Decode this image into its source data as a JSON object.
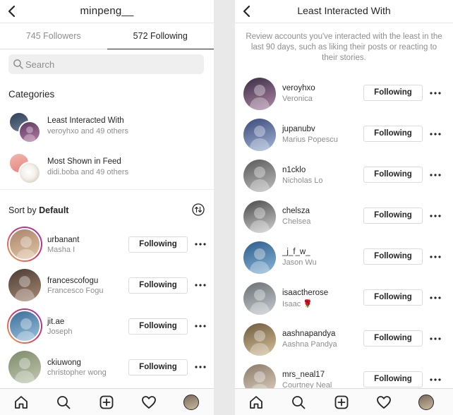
{
  "left": {
    "header": {
      "title": "minpeng__",
      "back_icon": "back-chevron-icon"
    },
    "tabs": [
      {
        "label": "745 Followers",
        "active": false
      },
      {
        "label": "572 Following",
        "active": true
      }
    ],
    "search": {
      "placeholder": "Search",
      "value": ""
    },
    "categories_heading": "Categories",
    "categories": [
      {
        "name": "Least Interacted With",
        "sub": "veroyhxo and 49 others"
      },
      {
        "name": "Most Shown in Feed",
        "sub": "didi.boba and 49 others"
      }
    ],
    "sort": {
      "prefix": "Sort by",
      "value": "Default"
    },
    "users": [
      {
        "username": "urbanant",
        "name": "Masha I",
        "button": "Following",
        "story_ring": true
      },
      {
        "username": "francescofogu",
        "name": "Francesco Fogu",
        "button": "Following",
        "story_ring": false
      },
      {
        "username": "jit.ae",
        "name": "Joseph",
        "button": "Following",
        "story_ring": true
      },
      {
        "username": "ckiuwong",
        "name": "christopher wong",
        "button": "Following",
        "story_ring": false
      }
    ]
  },
  "right": {
    "header": {
      "title": "Least Interacted With",
      "back_icon": "back-chevron-icon"
    },
    "description": "Review accounts you've interacted with the least in the last 90 days, such as liking their posts or reacting to their stories.",
    "users": [
      {
        "username": "veroyhxo",
        "name": "Veronica",
        "button": "Following"
      },
      {
        "username": "jupanubv",
        "name": "Marius Popescu",
        "button": "Following"
      },
      {
        "username": "n1cklo",
        "name": "Nicholas Lo",
        "button": "Following"
      },
      {
        "username": "chelsza",
        "name": "Chelsea",
        "button": "Following"
      },
      {
        "username": "_j_f_w_",
        "name": "Jason Wu",
        "button": "Following"
      },
      {
        "username": "isaactherose",
        "name": "Isaac 🌹",
        "button": "Following"
      },
      {
        "username": "aashnapandya",
        "name": "Aashna Pandya",
        "button": "Following"
      },
      {
        "username": "mrs_neal17",
        "name": "Courtney Neal",
        "button": "Following"
      }
    ]
  },
  "bottom_nav": [
    "home-icon",
    "search-icon",
    "new-post-icon",
    "activity-heart-icon",
    "profile-avatar"
  ],
  "colors": {
    "text": "#262626",
    "secondary": "#8e8e8e",
    "border": "#dbdbdb",
    "story_ring_start": "#f2a641",
    "story_ring_end": "#9b34b8"
  }
}
